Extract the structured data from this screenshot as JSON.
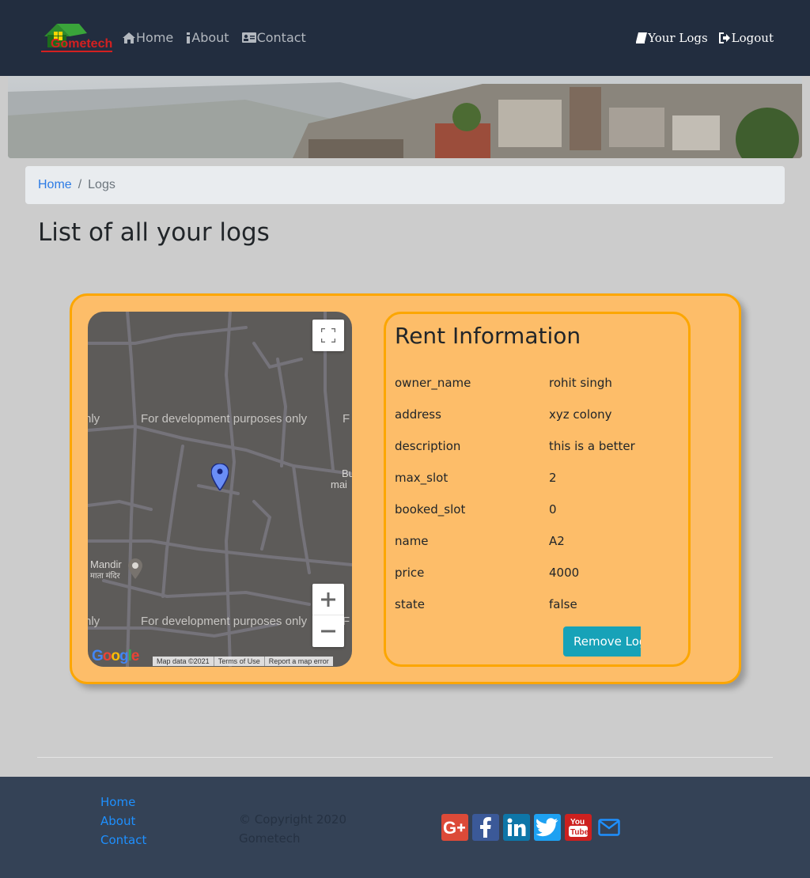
{
  "nav": {
    "brand": "Gometech",
    "links": [
      "Home",
      "About",
      "Contact"
    ],
    "right_links": [
      "Your Logs",
      "Logout"
    ]
  },
  "breadcrumb": {
    "home": "Home",
    "separator": "/",
    "current": "Logs"
  },
  "page_title": "List of all your logs",
  "map": {
    "watermark": "For development purposes only",
    "place_label": "Mandir",
    "place_label_hi": "माता मंदिर",
    "edge_label_1": "Bu",
    "edge_label_2": "mai",
    "attribution": [
      "Map data ©2021",
      "Terms of Use",
      "Report a map error"
    ],
    "provider": "Google"
  },
  "rent": {
    "title": "Rent Information",
    "rows": [
      {
        "key": "owner_name",
        "value": "rohit singh"
      },
      {
        "key": "address",
        "value": "xyz colony"
      },
      {
        "key": "description",
        "value": "this is a better"
      },
      {
        "key": "max_slot",
        "value": "2"
      },
      {
        "key": "booked_slot",
        "value": "0"
      },
      {
        "key": "name",
        "value": "A2"
      },
      {
        "key": "price",
        "value": "4000"
      },
      {
        "key": "state",
        "value": "false"
      }
    ],
    "remove_label": "Remove Log"
  },
  "footer": {
    "links": [
      "Home",
      "About",
      "Contact"
    ],
    "copyright": "© Copyright 2020 Gometech",
    "social": [
      "google-plus",
      "facebook",
      "linkedin",
      "twitter",
      "youtube",
      "email"
    ]
  },
  "colors": {
    "navbar": "#222d3f",
    "card": "#fdbd69",
    "card_border": "#fca600",
    "button": "#17a2b8",
    "footer": "#344256"
  }
}
